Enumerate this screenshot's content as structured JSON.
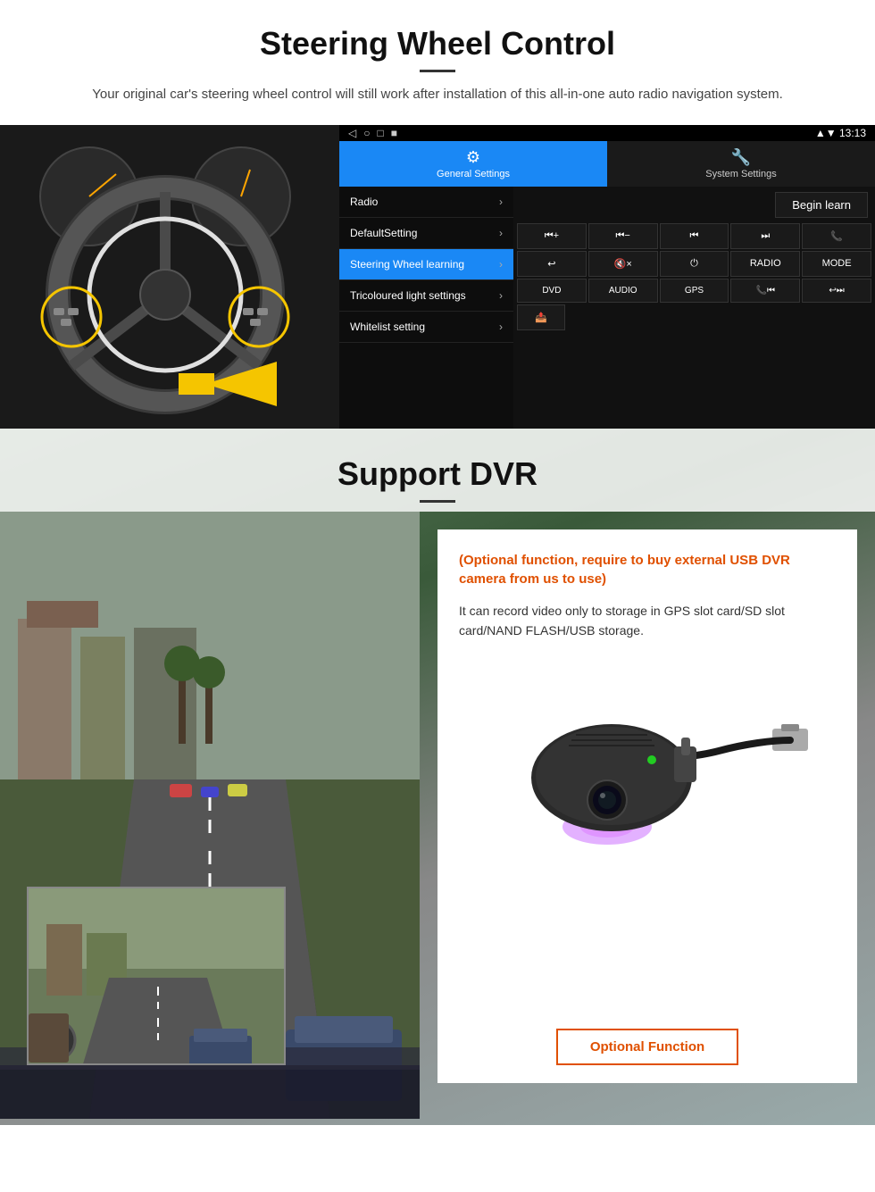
{
  "section1": {
    "title": "Steering Wheel Control",
    "description": "Your original car's steering wheel control will still work after installation of this all-in-one auto radio navigation system.",
    "android_ui": {
      "statusbar": {
        "icons_left": [
          "◁",
          "○",
          "□",
          "■"
        ],
        "time": "13:13",
        "signal": "▲ ▼"
      },
      "tabs": [
        {
          "label": "General Settings",
          "icon": "⚙",
          "active": true
        },
        {
          "label": "System Settings",
          "icon": "🔧",
          "active": false
        }
      ],
      "menu_items": [
        {
          "label": "Radio",
          "active": false
        },
        {
          "label": "DefaultSetting",
          "active": false
        },
        {
          "label": "Steering Wheel learning",
          "active": true
        },
        {
          "label": "Tricoloured light settings",
          "active": false
        },
        {
          "label": "Whitelist setting",
          "active": false
        }
      ],
      "begin_learn_label": "Begin learn",
      "control_buttons": [
        [
          "⏮+",
          "⏮−",
          "⏮⏮",
          "⏭⏭",
          "📞"
        ],
        [
          "↩",
          "🔇×",
          "⏻",
          "RADIO",
          "MODE"
        ],
        [
          "DVD",
          "AUDIO",
          "GPS",
          "📞⏮",
          "↩⏭"
        ],
        [
          "📤"
        ]
      ]
    }
  },
  "section2": {
    "title": "Support DVR",
    "card": {
      "optional_text": "(Optional function, require to buy external USB DVR camera from us to use)",
      "description": "It can record video only to storage in GPS slot card/SD slot card/NAND FLASH/USB storage.",
      "optional_function_btn": "Optional Function"
    }
  }
}
